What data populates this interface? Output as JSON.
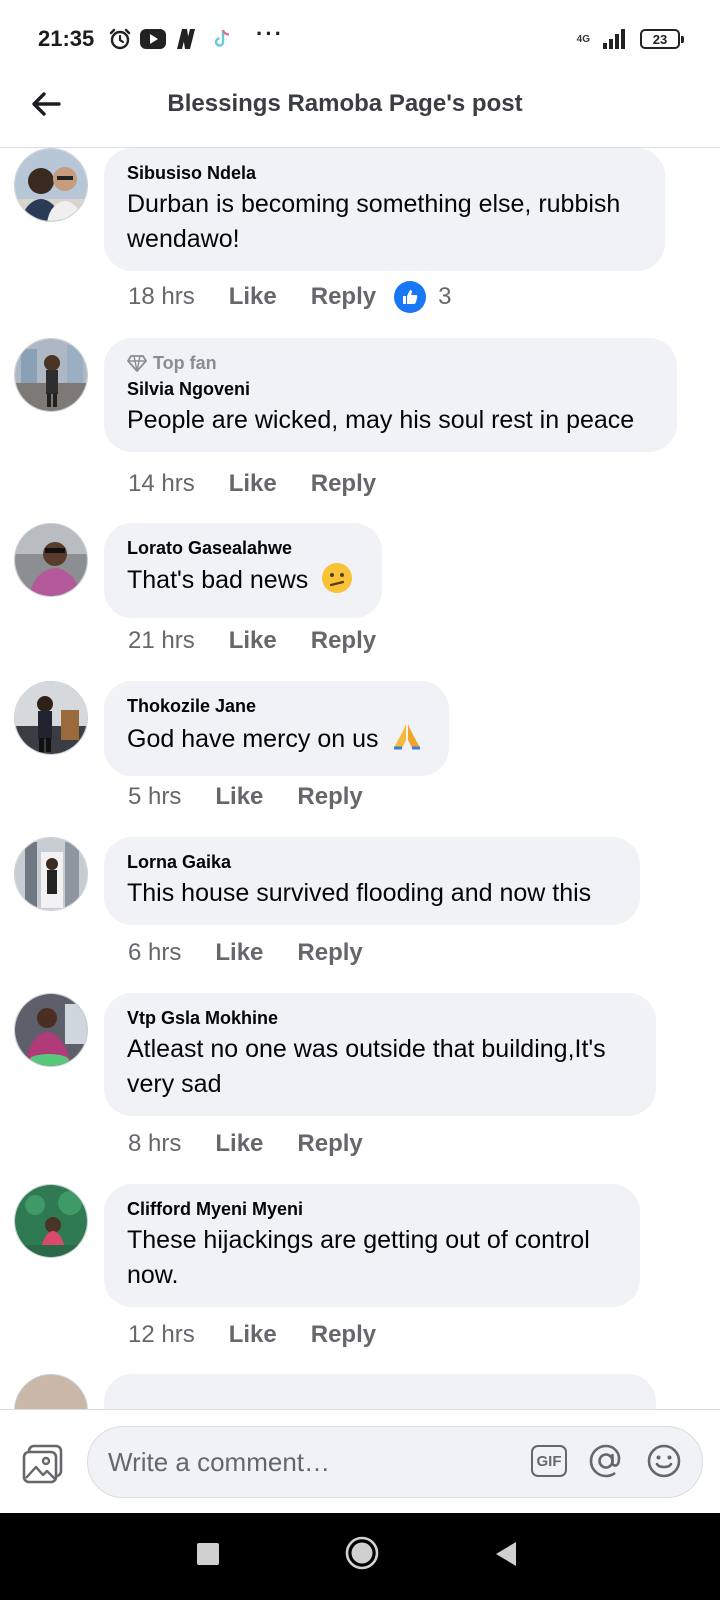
{
  "status_bar": {
    "time": "21:35",
    "network": "4G",
    "battery": "23"
  },
  "header": {
    "title": "Blessings Ramoba Page's post"
  },
  "comments": [
    {
      "author": "Sibusiso Ndela",
      "text": "Durban is becoming something else, rubbish wendawo!",
      "time": "18 hrs",
      "like": "Like",
      "reply": "Reply",
      "reactions": "3"
    },
    {
      "badge": "Top fan",
      "author": "Silvia Ngoveni",
      "text": "People are wicked, may his soul rest in peace",
      "time": "14 hrs",
      "like": "Like",
      "reply": "Reply"
    },
    {
      "author": "Lorato Gasealahwe",
      "text": "That's bad news",
      "time": "21 hrs",
      "like": "Like",
      "reply": "Reply"
    },
    {
      "author": "Thokozile Jane",
      "text": "God have mercy on us",
      "time": "5 hrs",
      "like": "Like",
      "reply": "Reply"
    },
    {
      "author": "Lorna Gaika",
      "text": "This house survived flooding and now this",
      "time": "6 hrs",
      "like": "Like",
      "reply": "Reply"
    },
    {
      "author": "Vtp Gsla Mokhine",
      "text": "Atleast no one was outside that building,It's very sad",
      "time": "8 hrs",
      "like": "Like",
      "reply": "Reply"
    },
    {
      "author": "Clifford Myeni Myeni",
      "text": "These hijackings are getting out of control now.",
      "time": "12 hrs",
      "like": "Like",
      "reply": "Reply"
    }
  ],
  "composer": {
    "placeholder": "Write a comment…",
    "gif_label": "GIF"
  },
  "colors": {
    "bubble": "#f0f2f5",
    "secondary_text": "#65676b",
    "like_blue": "#1877f2"
  }
}
